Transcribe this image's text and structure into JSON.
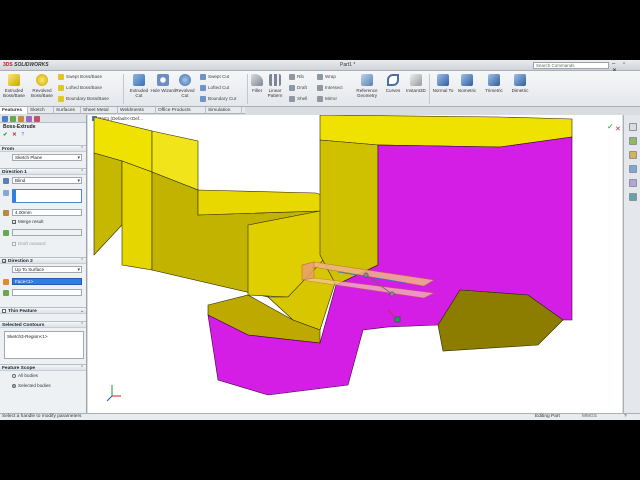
{
  "app": {
    "brand_ds": "3DS",
    "brand_name": "SOLIDWORKS",
    "document_title": "Part1 *",
    "search_placeholder": "Search Commands",
    "window_controls": "– ▫ ✕"
  },
  "ribbon": {
    "extruded_boss": "Extruded Boss/Base",
    "revolved_boss": "Revolved Boss/Base",
    "swept_boss": "Swept Boss/Base",
    "lofted_boss": "Lofted Boss/Base",
    "boundary_boss": "Boundary Boss/Base",
    "extruded_cut": "Extruded Cut",
    "hole_wizard": "Hole Wizard",
    "revolved_cut": "Revolved Cut",
    "swept_cut": "Swept Cut",
    "lofted_cut": "Lofted Cut",
    "boundary_cut": "Boundary Cut",
    "fillet": "Fillet",
    "linear_pattern": "Linear Pattern",
    "rib": "Rib",
    "draft": "Draft",
    "shell": "Shell",
    "wrap": "Wrap",
    "intersect": "Intersect",
    "mirror": "Mirror",
    "reference_geometry": "Reference Geometry",
    "curves": "Curves",
    "instant3d": "Instant3D",
    "normal_to": "Normal To",
    "isometric": "Isometric",
    "trimetric": "Trimetric",
    "dimetric": "Dimetric"
  },
  "tabs": [
    "Features",
    "Sketch",
    "Surfaces",
    "Sheet Metal",
    "Weldments",
    "Office Products",
    "Simulation"
  ],
  "property_manager": {
    "title": "Boss-Extrude",
    "ok": "✔",
    "cancel": "✕",
    "help": "?",
    "from_label": "From",
    "from_value": "Sketch Plane",
    "direction1_label": "Direction 1",
    "direction1_type": "Blind",
    "depth_value": "4.00mm",
    "merge_result": "Merge result",
    "draft_outward": "Draft outward",
    "direction2_label": "Direction 2",
    "direction2_type": "Up To Surface",
    "direction2_face": "Face<1>",
    "thin_feature": "Thin Feature",
    "selected_contours_label": "Selected Contours",
    "selected_contour_item": "Sketch3-Region<1>",
    "feature_scope_label": "Feature Scope",
    "all_bodies": "All bodies",
    "selected_bodies": "Selected bodies"
  },
  "viewport": {
    "tree_flyout": "Part1 (Default<<Def..."
  },
  "status": {
    "message": "Select a handle to modify parameters",
    "mode": "Editing Part",
    "units": "MMGS",
    "help": "?"
  },
  "colors": {
    "yellow_face": "#f0e200",
    "yellow_shade": "#b8a900",
    "magenta_face": "#d41ee6",
    "preview": "#f2b48a",
    "accent_blue": "#2f7ee0"
  }
}
